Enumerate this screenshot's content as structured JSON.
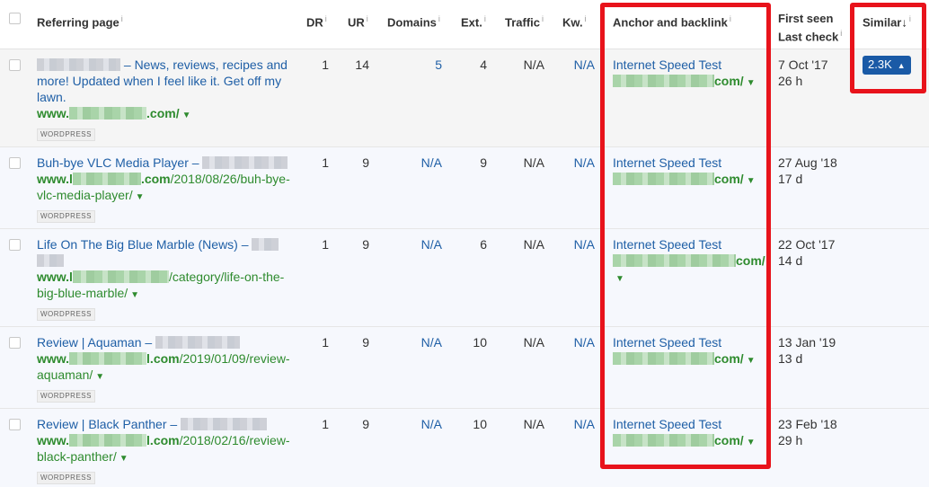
{
  "columns": {
    "referring_page": "Referring page",
    "dr": "DR",
    "ur": "UR",
    "domains": "Domains",
    "ext": "Ext.",
    "traffic": "Traffic",
    "kw": "Kw.",
    "anchor_backlink": "Anchor and backlink",
    "first_seen": "First seen",
    "last_check": "Last check",
    "similar": "Similar",
    "sort_arrow": "↓",
    "info_mark": "i"
  },
  "rows": [
    {
      "title_suffix": "– News, reviews, recipes and more! Updated when I feel like it. Get off my lawn.",
      "url_prefix": "www.",
      "url_suffix": ".com/",
      "tag": "WORDPRESS",
      "dr": "1",
      "ur": "14",
      "domains": "5",
      "ext": "4",
      "traffic": "N/A",
      "kw": "N/A",
      "anchor": "Internet Speed Test",
      "backlink_suffix": "com/",
      "first_seen": "7 Oct '17",
      "last_check": "26 h",
      "similar": "2.3K"
    },
    {
      "title": "Buh-bye VLC Media Player –",
      "url_prefix": "www.l",
      "url_domain_end": ".com",
      "url_path": "/2018/08/26/buh-bye-vlc-media-player/",
      "tag": "WORDPRESS",
      "dr": "1",
      "ur": "9",
      "domains": "N/A",
      "ext": "9",
      "traffic": "N/A",
      "kw": "N/A",
      "anchor": "Internet Speed Test",
      "backlink_suffix": "com/",
      "first_seen": "27 Aug '18",
      "last_check": "17 d"
    },
    {
      "title": "Life On The Big Blue Marble (News) –",
      "url_prefix": "www.l",
      "url_path": "/category/life-on-the-big-blue-marble/",
      "tag": "WORDPRESS",
      "dr": "1",
      "ur": "9",
      "domains": "N/A",
      "ext": "6",
      "traffic": "N/A",
      "kw": "N/A",
      "anchor": "Internet Speed Test",
      "backlink_suffix": "com/",
      "first_seen": "22 Oct '17",
      "last_check": "14 d"
    },
    {
      "title": "Review | Aquaman –",
      "url_prefix": "www.",
      "url_domain_end": "l.com",
      "url_path": "/2019/01/09/review-aquaman/",
      "tag": "WORDPRESS",
      "dr": "1",
      "ur": "9",
      "domains": "N/A",
      "ext": "10",
      "traffic": "N/A",
      "kw": "N/A",
      "anchor": "Internet Speed Test",
      "backlink_suffix": "com/",
      "first_seen": "13 Jan '19",
      "last_check": "13 d"
    },
    {
      "title": "Review | Black Panther –",
      "url_prefix": "www.",
      "url_domain_end": "l.com",
      "url_path": "/2018/02/16/review-black-panther/",
      "tag": "WORDPRESS",
      "dr": "1",
      "ur": "9",
      "domains": "N/A",
      "ext": "10",
      "traffic": "N/A",
      "kw": "N/A",
      "anchor": "Internet Speed Test",
      "backlink_suffix": "com/",
      "first_seen": "23 Feb '18",
      "last_check": "29 h"
    }
  ],
  "colors": {
    "link": "#1f5fa6",
    "url_green": "#2e8b2e",
    "highlight_red": "#e8131b",
    "similar_badge": "#1a5aa6"
  },
  "icons": {
    "dropdown": "chevron-down-icon",
    "sort": "sort-down-arrow-icon",
    "info": "info-icon",
    "similar_expand": "caret-up-icon"
  }
}
